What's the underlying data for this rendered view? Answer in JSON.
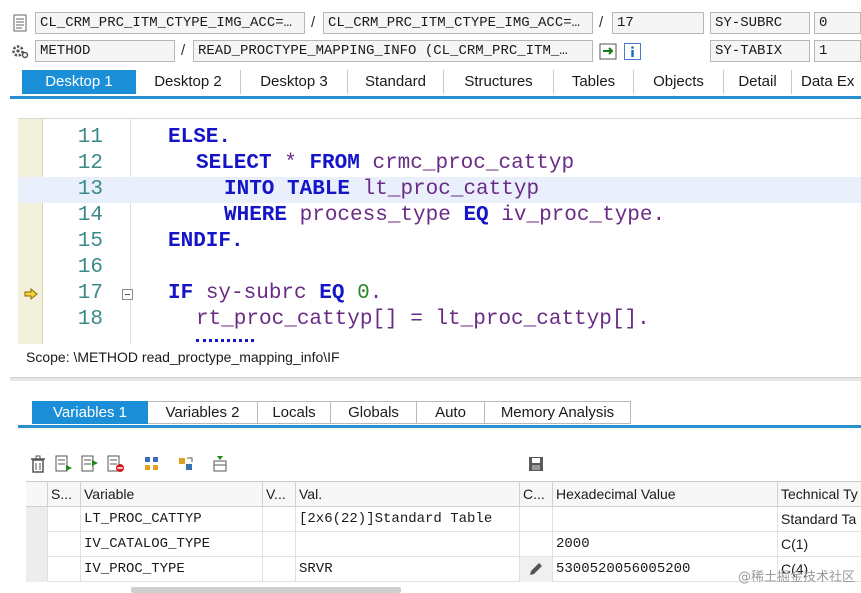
{
  "header": {
    "row1": {
      "field1": "CL_CRM_PRC_ITM_CTYPE_IMG_ACC=…",
      "sep1": "/",
      "field2": "CL_CRM_PRC_ITM_CTYPE_IMG_ACC=…",
      "sep2": "/",
      "field3": "17",
      "sys_label": "SY-SUBRC",
      "sys_value": "0"
    },
    "row2": {
      "field1": "METHOD",
      "sep1": "/",
      "field2": "READ_PROCTYPE_MAPPING_INFO (CL_CRM_PRC_ITM_…",
      "sys_label": "SY-TABIX",
      "sys_value": "1"
    }
  },
  "desktop_tabs": [
    "Desktop 1",
    "Desktop 2",
    "Desktop 3",
    "Standard",
    "Structures",
    "Tables",
    "Objects",
    "Detail",
    "Data Ex"
  ],
  "editor": {
    "lines": [
      {
        "num": "11"
      },
      {
        "num": "12"
      },
      {
        "num": "13"
      },
      {
        "num": "14"
      },
      {
        "num": "15"
      },
      {
        "num": "16"
      },
      {
        "num": "17"
      },
      {
        "num": "18"
      }
    ],
    "tokens": {
      "l11_kw": "ELSE.",
      "l12_kw1": "SELECT",
      "l12_star": " * ",
      "l12_kw2": "FROM",
      "l12_id": " crmc_proc_cattyp",
      "l13_kw": "INTO TABLE",
      "l13_id": " lt_proc_cattyp",
      "l14_kw": "WHERE",
      "l14_id1": " process_type ",
      "l14_kw2": "EQ",
      "l14_id2": " iv_proc_type.",
      "l15_kw": "ENDIF.",
      "l17_kw": "IF",
      "l17_id": " sy-subrc ",
      "l17_kw2": "EQ",
      "l17_num": " 0",
      "l17_dot": ".",
      "l18_id": "rt_proc_cattyp[] = lt_proc_cattyp[]."
    }
  },
  "scope": "Scope: \\METHOD read_proctype_mapping_info\\IF",
  "variable_tabs": [
    "Variables 1",
    "Variables 2",
    "Locals",
    "Globals",
    "Auto",
    "Memory Analysis"
  ],
  "table": {
    "columns": [
      "S...",
      "Variable",
      "V...",
      "Val.",
      "C...",
      "Hexadecimal Value",
      "Technical Ty"
    ],
    "rows": [
      {
        "variable": "LT_PROC_CATTYP",
        "value": "[2x6(22)]Standard Table",
        "hex": "",
        "technical": "Standard Ta"
      },
      {
        "variable": "IV_CATALOG_TYPE",
        "value": "",
        "hex": "2000",
        "technical": "C(1)"
      },
      {
        "variable": "IV_PROC_TYPE",
        "value": "SRVR",
        "hex": "5300520056005200",
        "technical": "C(4)"
      }
    ]
  },
  "watermark": "@稀土掘金技术社区",
  "colors": {
    "accent": "#1a8fd8",
    "keyword": "#1414c8",
    "identifier": "#6a2b86",
    "line_number": "#3a8a8a",
    "number": "#2a8a2a"
  }
}
